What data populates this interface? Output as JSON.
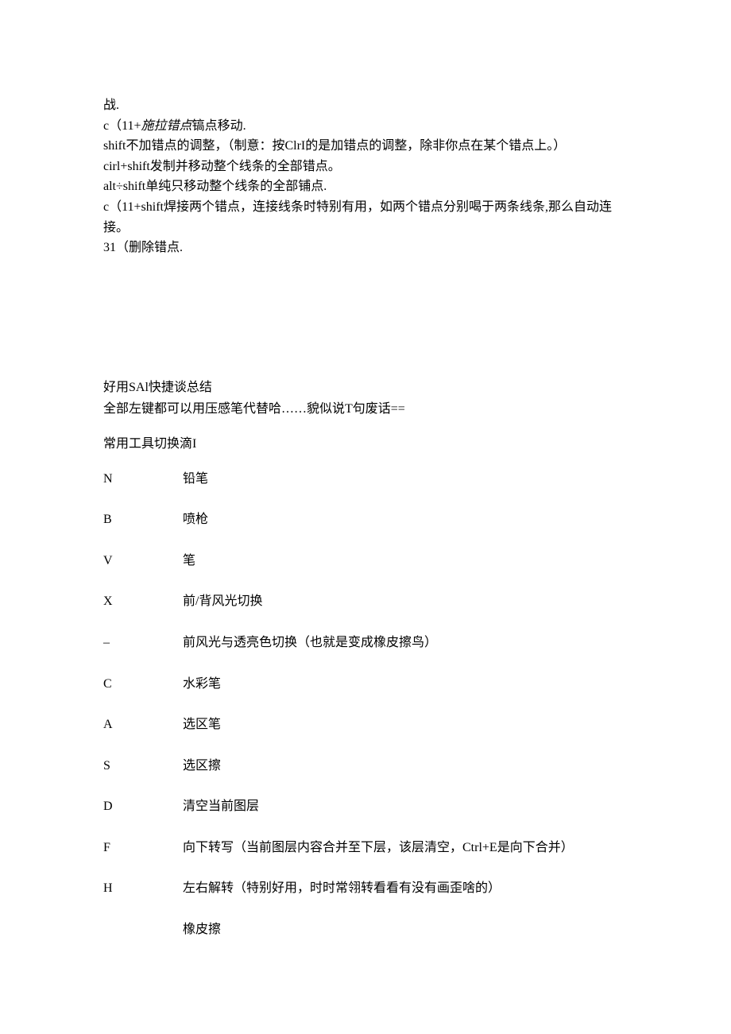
{
  "topSection": {
    "lines": [
      "战.",
      "c（11+施拉错点镐点移动.",
      "shift不加错点的调整，（制意：按ClrI的是加错点的调整，除非你点在某个错点上。）",
      "cirl+shift发制并移动整个线条的全部错点。",
      "alt÷shift单纯只移动整个线条的全部铺点.",
      "c（11+shift焊接两个错点，连接线条时特别有用，如两个错点分别喝于两条线条,那么自动连接。",
      "31（删除错点."
    ],
    "italicSegment": "施拉错点"
  },
  "midSection": {
    "title": "好用SAl快捷谈总结",
    "subtitle": "全部左键都可以用压感笔代替哈……貌似说T句废话==",
    "subheading": "常用工具切换滴I"
  },
  "shortcuts": [
    {
      "key": "N",
      "desc": "铅笔"
    },
    {
      "key": "B",
      "desc": "喷枪"
    },
    {
      "key": "V",
      "desc": "笔"
    },
    {
      "key": "X",
      "desc": "前/背风光切换"
    },
    {
      "key": "–",
      "desc": "前风光与透亮色切换（也就是变成橡皮擦鸟）"
    },
    {
      "key": "C",
      "desc": "水彩笔"
    },
    {
      "key": "A",
      "desc": "选区笔"
    },
    {
      "key": "S",
      "desc": "选区擦"
    },
    {
      "key": "D",
      "desc": "清空当前图层"
    },
    {
      "key": "F",
      "desc": "向下转写（当前图层内容合并至下层，该层清空，Ctrl+E是向下合并）"
    },
    {
      "key": "H",
      "desc": "左右解转（特别好用，时时常翎转看看有没有画歪啥的）"
    },
    {
      "key": "",
      "desc": "橡皮擦"
    }
  ]
}
